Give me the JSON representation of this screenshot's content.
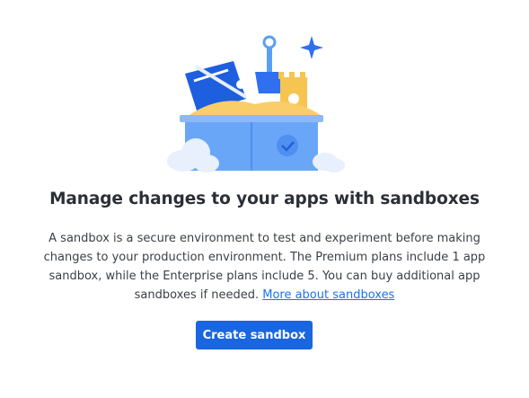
{
  "empty_state": {
    "title": "Manage changes to your apps with sandboxes",
    "description": "A sandbox is a secure environment to test and experiment before making changes to your production environment. The Premium plans include 1 app sandbox, while the Enterprise plans include 5. You can buy additional app sandboxes if needed.",
    "link_label": "More about sandboxes",
    "button_label": "Create sandbox"
  },
  "illustration": {
    "name": "sandbox-illustration"
  },
  "colors": {
    "primary_button": "#1a66e0",
    "link": "#1a73e8",
    "box_blue": "#6aa6f8",
    "sand": "#f8cd6a"
  }
}
